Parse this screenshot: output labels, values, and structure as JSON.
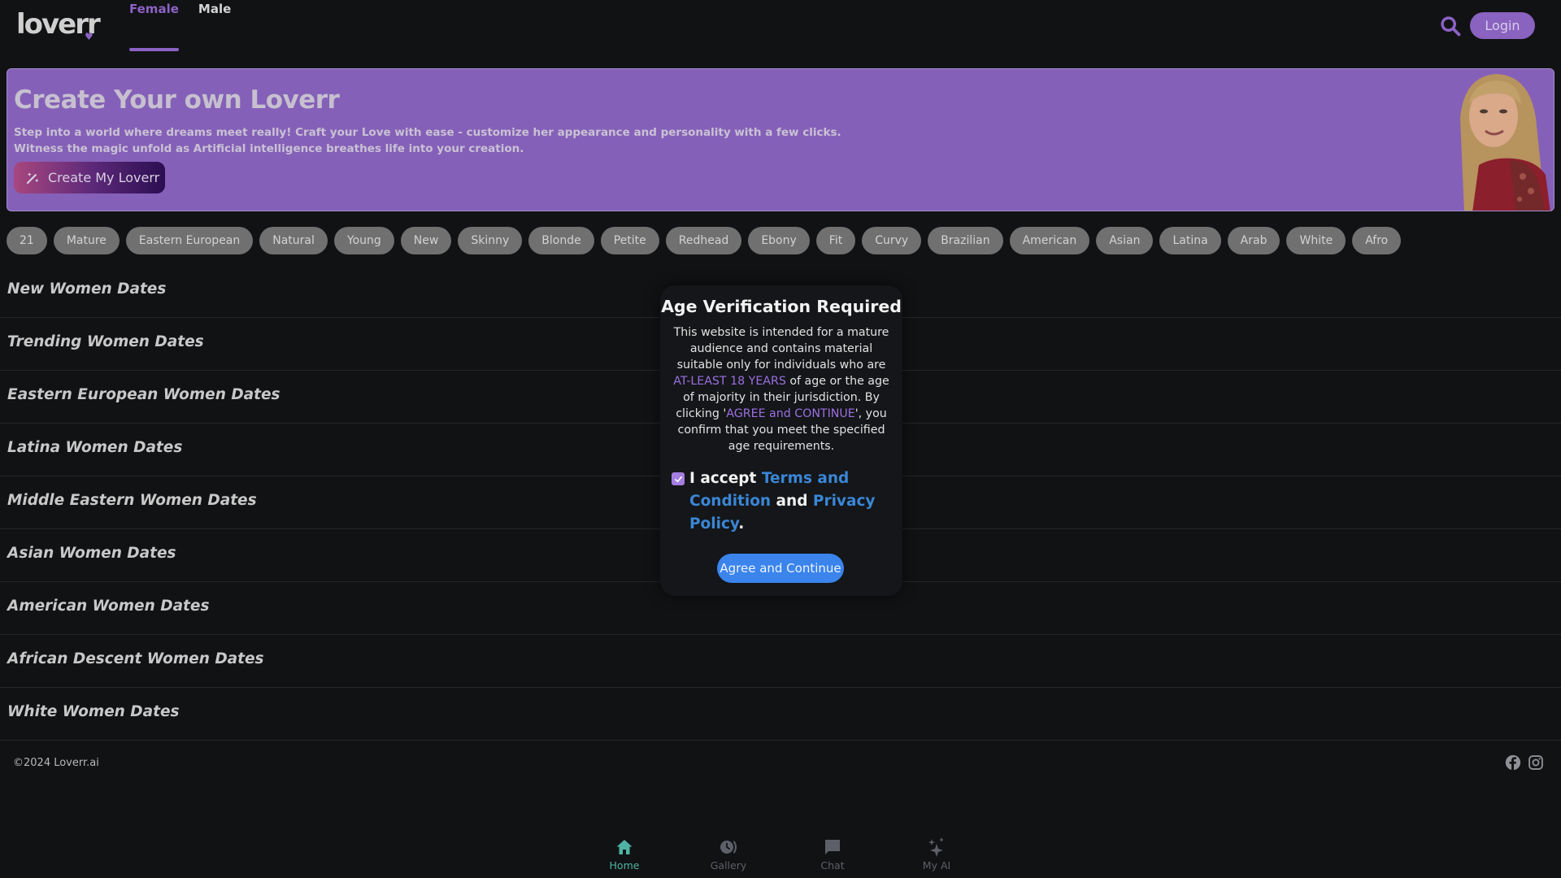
{
  "header": {
    "logo": "loverr",
    "tabs": [
      {
        "label": "Female",
        "active": true
      },
      {
        "label": "Male",
        "active": false
      }
    ],
    "login_label": "Login",
    "accent_color": "#8c62c6"
  },
  "banner": {
    "title": "Create Your own Loverr",
    "desc_line1": "Step into a world where dreams meet really! Craft your Love with ease - customize her appearance and personality with a few clicks.",
    "desc_line2": "Witness the magic unfold as Artificial intelligence breathes life into your creation.",
    "cta_label": "Create My Loverr"
  },
  "chips": [
    "21",
    "Mature",
    "Eastern European",
    "Natural",
    "Young",
    "New",
    "Skinny",
    "Blonde",
    "Petite",
    "Redhead",
    "Ebony",
    "Fit",
    "Curvy",
    "Brazilian",
    "American",
    "Asian",
    "Latina",
    "Arab",
    "White",
    "Afro"
  ],
  "sections": [
    "New Women Dates",
    "Trending Women Dates",
    "Eastern European Women Dates",
    "Latina Women Dates",
    "Middle Eastern Women Dates",
    "Asian Women Dates",
    "American Women Dates",
    "African Descent Women Dates",
    "White Women Dates"
  ],
  "footer": {
    "copyright": "©2024 Loverr.ai",
    "social": [
      "facebook-icon",
      "instagram-icon"
    ]
  },
  "bottom_nav": [
    {
      "label": "Home",
      "icon": "home-icon",
      "active": true
    },
    {
      "label": "Gallery",
      "icon": "gallery-icon",
      "active": false
    },
    {
      "label": "Chat",
      "icon": "chat-icon",
      "active": false
    },
    {
      "label": "My AI",
      "icon": "sparkles-icon",
      "active": false
    }
  ],
  "modal": {
    "title": "Age Verification Required",
    "body_part1": "This website is intended for a mature audience and contains material suitable only for individuals who are ",
    "body_highlight1": "AT-LEAST 18 YEARS",
    "body_part2": " of age or the age of majority in their jurisdiction. By clicking '",
    "body_highlight2": "AGREE and CONTINUE",
    "body_part3": "', you confirm that you meet the specified age requirements.",
    "accept_prefix": "I accept ",
    "terms_link": "Terms and Condition",
    "accept_and": " and ",
    "privacy_link": "Privacy Policy",
    "accept_suffix": ".",
    "checkbox_checked": true,
    "agree_label": "Agree and Continue",
    "agree_color": "#3a84ec"
  }
}
